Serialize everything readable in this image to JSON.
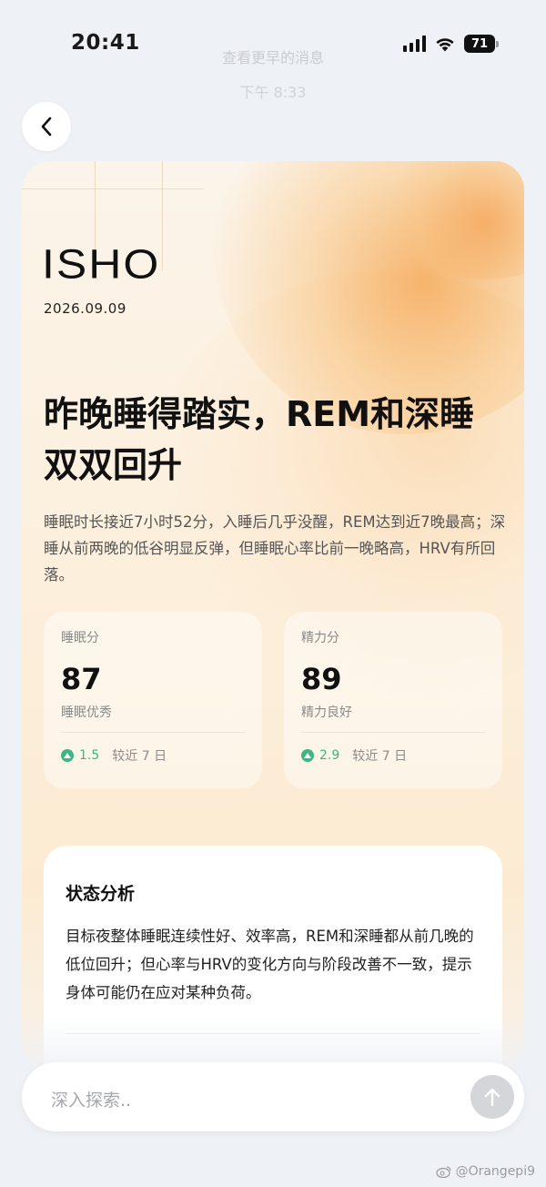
{
  "status_bar": {
    "time": "20:41",
    "battery": "71"
  },
  "background_notice": {
    "line1": "查看更早的消息",
    "line2": "下午 8:33"
  },
  "report": {
    "brand": "ISHO",
    "date": "2026.09.09",
    "headline": "昨晚睡得踏实，REM和深睡双双回升",
    "summary": "睡眠时长接近7小时52分，入睡后几乎没醒，REM达到近7晚最高；深睡从前两晚的低谷明显反弹，但睡眠心率比前一晚略高，HRV有所回落。",
    "scores": [
      {
        "label": "睡眠分",
        "value": "87",
        "status": "睡眠优秀",
        "delta": "1.5",
        "compare": "较近 7 日",
        "trend": "up"
      },
      {
        "label": "精力分",
        "value": "89",
        "status": "精力良好",
        "delta": "2.9",
        "compare": "较近 7 日",
        "trend": "up"
      }
    ],
    "analysis": {
      "title": "状态分析",
      "text": "目标夜整体睡眠连续性好、效率高，REM和深睡都从前几晚的低位回升；但心率与HRV的变化方向与阶段改善不一致，提示身体可能仍在应对某种负荷。"
    }
  },
  "input": {
    "placeholder": "深入探索.."
  },
  "watermark": "@Orangepi9",
  "colors": {
    "accent_orange": "#f5aa5a",
    "trend_green": "#39b981",
    "background": "#eef1f5"
  }
}
